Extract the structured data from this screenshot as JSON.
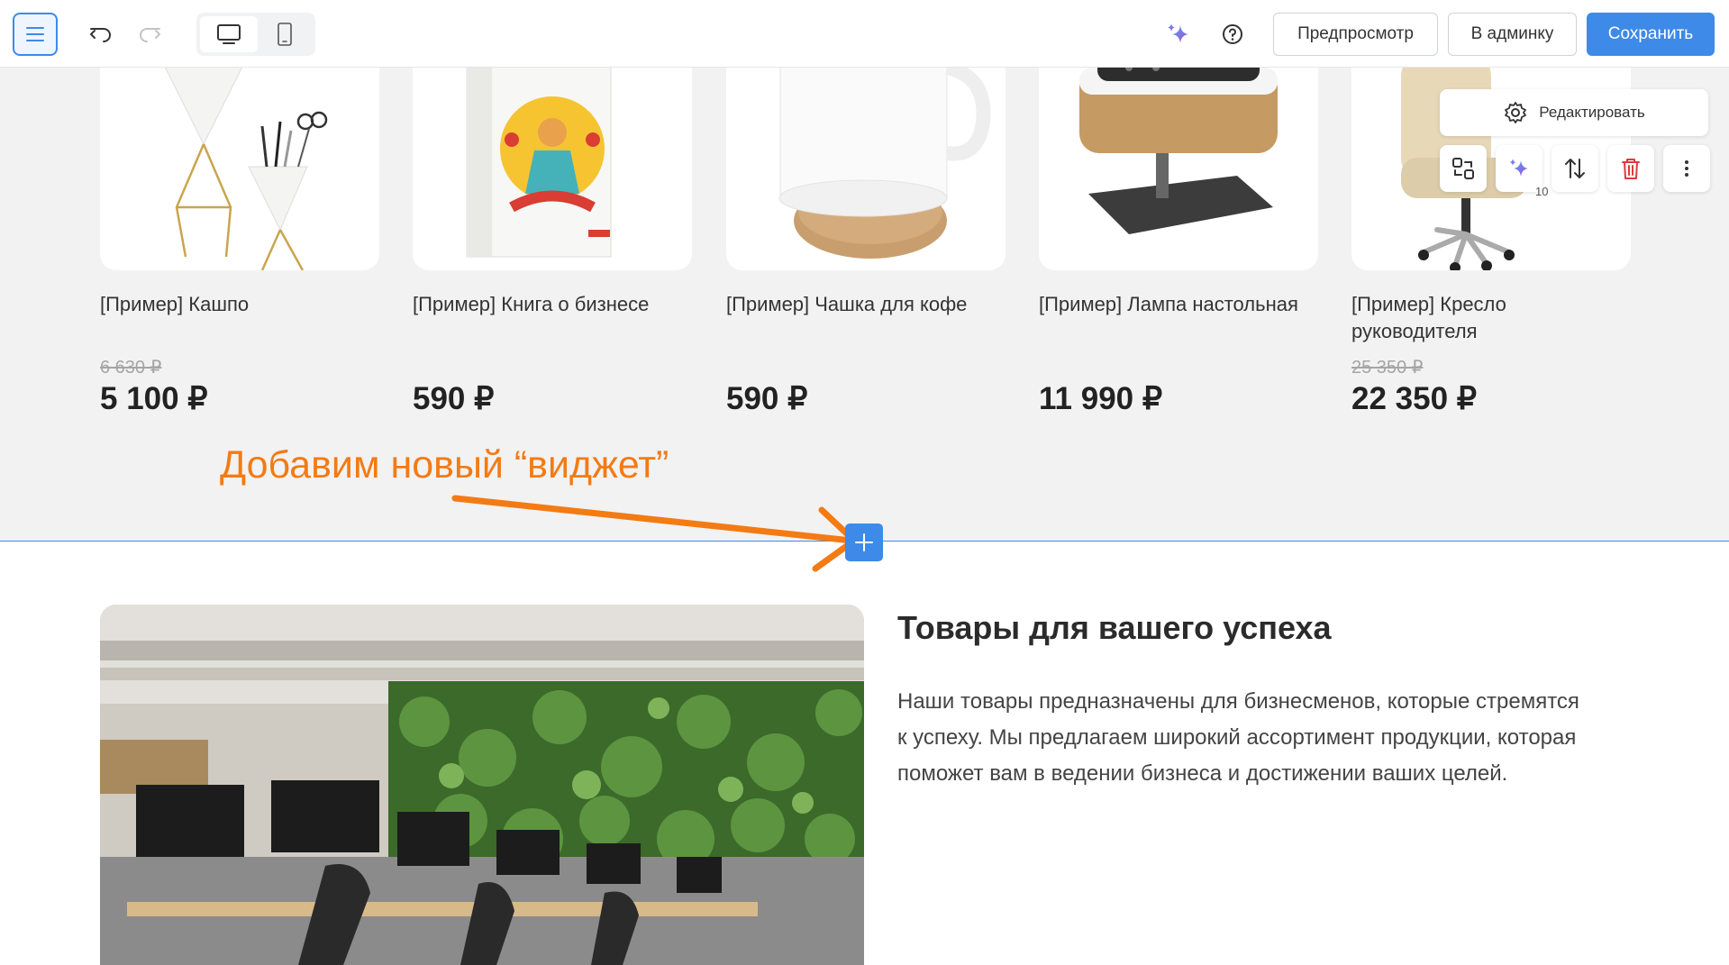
{
  "toolbar": {
    "preview_label": "Предпросмотр",
    "admin_label": "В админку",
    "save_label": "Сохранить",
    "accent_color": "#3d8ae8"
  },
  "products": [
    {
      "name": "[Пример] Кашпо",
      "old_price": "6 630 ₽",
      "price": "5 100 ₽"
    },
    {
      "name": "[Пример] Книга о бизнесе",
      "old_price": "",
      "price": "590 ₽"
    },
    {
      "name": "[Пример] Чашка для кофе",
      "old_price": "",
      "price": "590 ₽"
    },
    {
      "name": "[Пример] Лампа настольная",
      "old_price": "",
      "price": "11 990 ₽"
    },
    {
      "name": "[Пример] Кресло руководителя",
      "old_price": "25 350 ₽",
      "price": "22 350 ₽"
    }
  ],
  "block_tools": {
    "edit_label": "Редактировать",
    "ai_count": "10"
  },
  "annotation": {
    "text": "Добавим новый “виджет”",
    "color": "#f37b13"
  },
  "info": {
    "title": "Товары для вашего успеха",
    "text": "Наши товары предназначены для бизнесменов, которые стремятся к успеху. Мы предлагаем широкий ассортимент продукции, которая поможет вам в ведении бизнеса и достижении ваших целей."
  }
}
